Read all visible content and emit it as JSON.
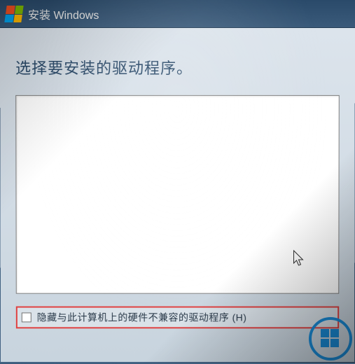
{
  "titlebar": {
    "title": "安装 Windows"
  },
  "main": {
    "heading": "选择要安装的驱动程序。",
    "hide_incompatible_label": "隐藏与此计算机上的硬件不兼容的驱动程序 (H)"
  }
}
